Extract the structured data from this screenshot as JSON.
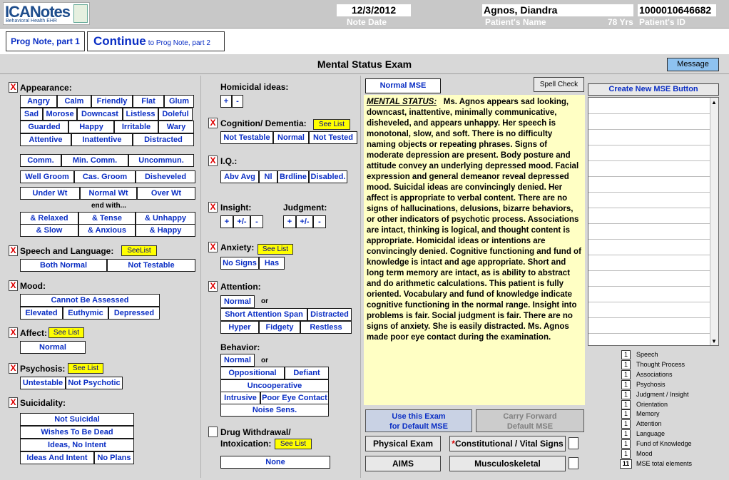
{
  "header": {
    "logo_main": "ICANotes",
    "logo_sub": "Behavioral Health EHR",
    "note_date": "12/3/2012",
    "note_date_label": "Note Date",
    "patient_name": "Agnos, Diandra",
    "patient_name_label": "Patient's Name",
    "patient_age": "78 Yrs",
    "patient_id": "1000010646682",
    "patient_id_label": "Patient's ID"
  },
  "nav": {
    "prog1": "Prog Note, part 1",
    "continue_big": "Continue",
    "continue_small": "to Prog Note, part 2"
  },
  "title": "Mental Status Exam",
  "message_button": "Message",
  "appearance": {
    "label": "Appearance:",
    "row1": [
      "Angry",
      "Calm",
      "Friendly",
      "Flat",
      "Glum"
    ],
    "row2": [
      "Sad",
      "Morose",
      "Downcast",
      "Listless",
      "Doleful"
    ],
    "row3": [
      "Guarded",
      "Happy",
      "Irritable",
      "Wary"
    ],
    "row4": [
      "Attentive",
      "Inattentive",
      "Distracted"
    ],
    "row5": [
      "Comm.",
      "Min. Comm.",
      "Uncommun."
    ],
    "row6": [
      "Well Groom",
      "Cas. Groom",
      "Disheveled"
    ],
    "row7": [
      "Under Wt",
      "Normal Wt",
      "Over Wt"
    ],
    "end_with": "end with...",
    "row8": [
      "& Relaxed",
      "& Tense",
      "& Unhappy"
    ],
    "row9": [
      "& Slow",
      "& Anxious",
      "& Happy"
    ]
  },
  "speech": {
    "label": "Speech and Language:",
    "see": "SeeList",
    "opts": [
      "Both Normal",
      "Not Testable"
    ]
  },
  "mood": {
    "label": "Mood:",
    "opts": [
      "Cannot Be Assessed",
      "Elevated",
      "Euthymic",
      "Depressed"
    ]
  },
  "affect": {
    "label": "Affect:",
    "see": "See List",
    "opts": [
      "Normal"
    ]
  },
  "psychosis": {
    "label": "Psychosis:",
    "see": "See List",
    "opts": [
      "Untestable",
      "Not Psychotic"
    ]
  },
  "suicidality": {
    "label": "Suicidality:",
    "opts": [
      "Not Suicidal",
      "Wishes To Be Dead",
      "Ideas, No Intent",
      "Ideas And Intent",
      "No Plans"
    ]
  },
  "homicidal": {
    "label": "Homicidal ideas:",
    "opts": [
      "+",
      "-"
    ]
  },
  "cognition": {
    "label": "Cognition/ Dementia:",
    "see": "See List",
    "opts": [
      "Not Testable",
      "Normal",
      "Not Tested"
    ]
  },
  "iq": {
    "label": "I.Q.:",
    "opts": [
      "Abv Avg",
      "Nl",
      "Brdline",
      "Disabled."
    ]
  },
  "insight": {
    "label": "Insight:",
    "opts": [
      "+",
      "+/-",
      "-"
    ]
  },
  "judgment": {
    "label": "Judgment:",
    "opts": [
      "+",
      "+/-",
      "-"
    ]
  },
  "anxiety": {
    "label": "Anxiety:",
    "see": "See List",
    "opts": [
      "No Signs",
      "Has"
    ]
  },
  "attention": {
    "label": "Attention:",
    "or": "or",
    "opts": [
      "Normal",
      "Short Attention Span",
      "Distracted",
      "Hyper",
      "Fidgety",
      "Restless"
    ]
  },
  "behavior": {
    "label": "Behavior:",
    "or": "or",
    "opts": [
      "Normal",
      "Oppositional",
      "Defiant",
      "Uncooperative",
      "Intrusive",
      "Poor Eye Contact",
      "Noise Sens."
    ]
  },
  "drug": {
    "label1": "Drug Withdrawal/",
    "label2": "Intoxication:",
    "see": "See List",
    "opts": [
      "None"
    ]
  },
  "note": {
    "normal_mse": "Normal MSE",
    "spell_check": "Spell Check",
    "heading": "MENTAL STATUS:",
    "body": "Ms. Agnos appears sad looking,  downcast,  inattentive, minimally communicative, disheveled,  and appears unhappy. Her speech is  monotonal, slow, and soft. There is no difficulty naming objects or repeating phrases. Signs of moderate depression are present.  Body posture and attitude convey an underlying depressed mood. Facial expression and general demeanor reveal depressed mood.  Suicidal ideas are convincingly denied.  Her affect is appropriate to verbal content.  There are no signs of hallucinations, delusions, bizarre behaviors, or other indicators of psychotic process. Associations are intact, thinking is logical, and thought content is appropriate.  Homicidal ideas or intentions are convincingly denied.  Cognitive functioning and fund of knowledge is intact and age appropriate.  Short and long term memory are intact, as is ability to abstract and do arithmetic calculations. This patient is fully oriented. Vocabulary and fund of knowledge indicate cognitive functioning in the normal range. Insight into problems is fair.  Social judgment is fair. There are no signs of anxiety. She is easily distracted. Ms. Agnos made poor eye contact during the examination."
  },
  "bottom": {
    "use_exam_1": "Use this Exam",
    "use_exam_2": "for Default MSE",
    "carry_1": "Carry Forward",
    "carry_2": "Default MSE",
    "physical": "Physical Exam",
    "constitutional_star": "*",
    "constitutional": "Constitutional / Vital Signs",
    "aims": "AIMS",
    "musculo": "Musculoskeletal"
  },
  "right": {
    "create_button": "Create New MSE Button",
    "counts": [
      {
        "n": "1",
        "label": "Speech"
      },
      {
        "n": "1",
        "label": "Thought Process"
      },
      {
        "n": "1",
        "label": "Associations"
      },
      {
        "n": "1",
        "label": "Psychosis"
      },
      {
        "n": "1",
        "label": "Judgment / Insight"
      },
      {
        "n": "1",
        "label": "Orientation"
      },
      {
        "n": "1",
        "label": "Memory"
      },
      {
        "n": "1",
        "label": "Attention"
      },
      {
        "n": "1",
        "label": "Language"
      },
      {
        "n": "1",
        "label": "Fund of Knowledge"
      },
      {
        "n": "1",
        "label": "Mood"
      },
      {
        "n": "11",
        "label": "MSE total elements"
      }
    ]
  },
  "checks": {
    "x": "X"
  },
  "colors": {
    "accent_blue": "#0a2ec4",
    "note_bg": "#ffffc4",
    "see_list": "#ffff00",
    "message_bg": "#8ec2f0"
  }
}
